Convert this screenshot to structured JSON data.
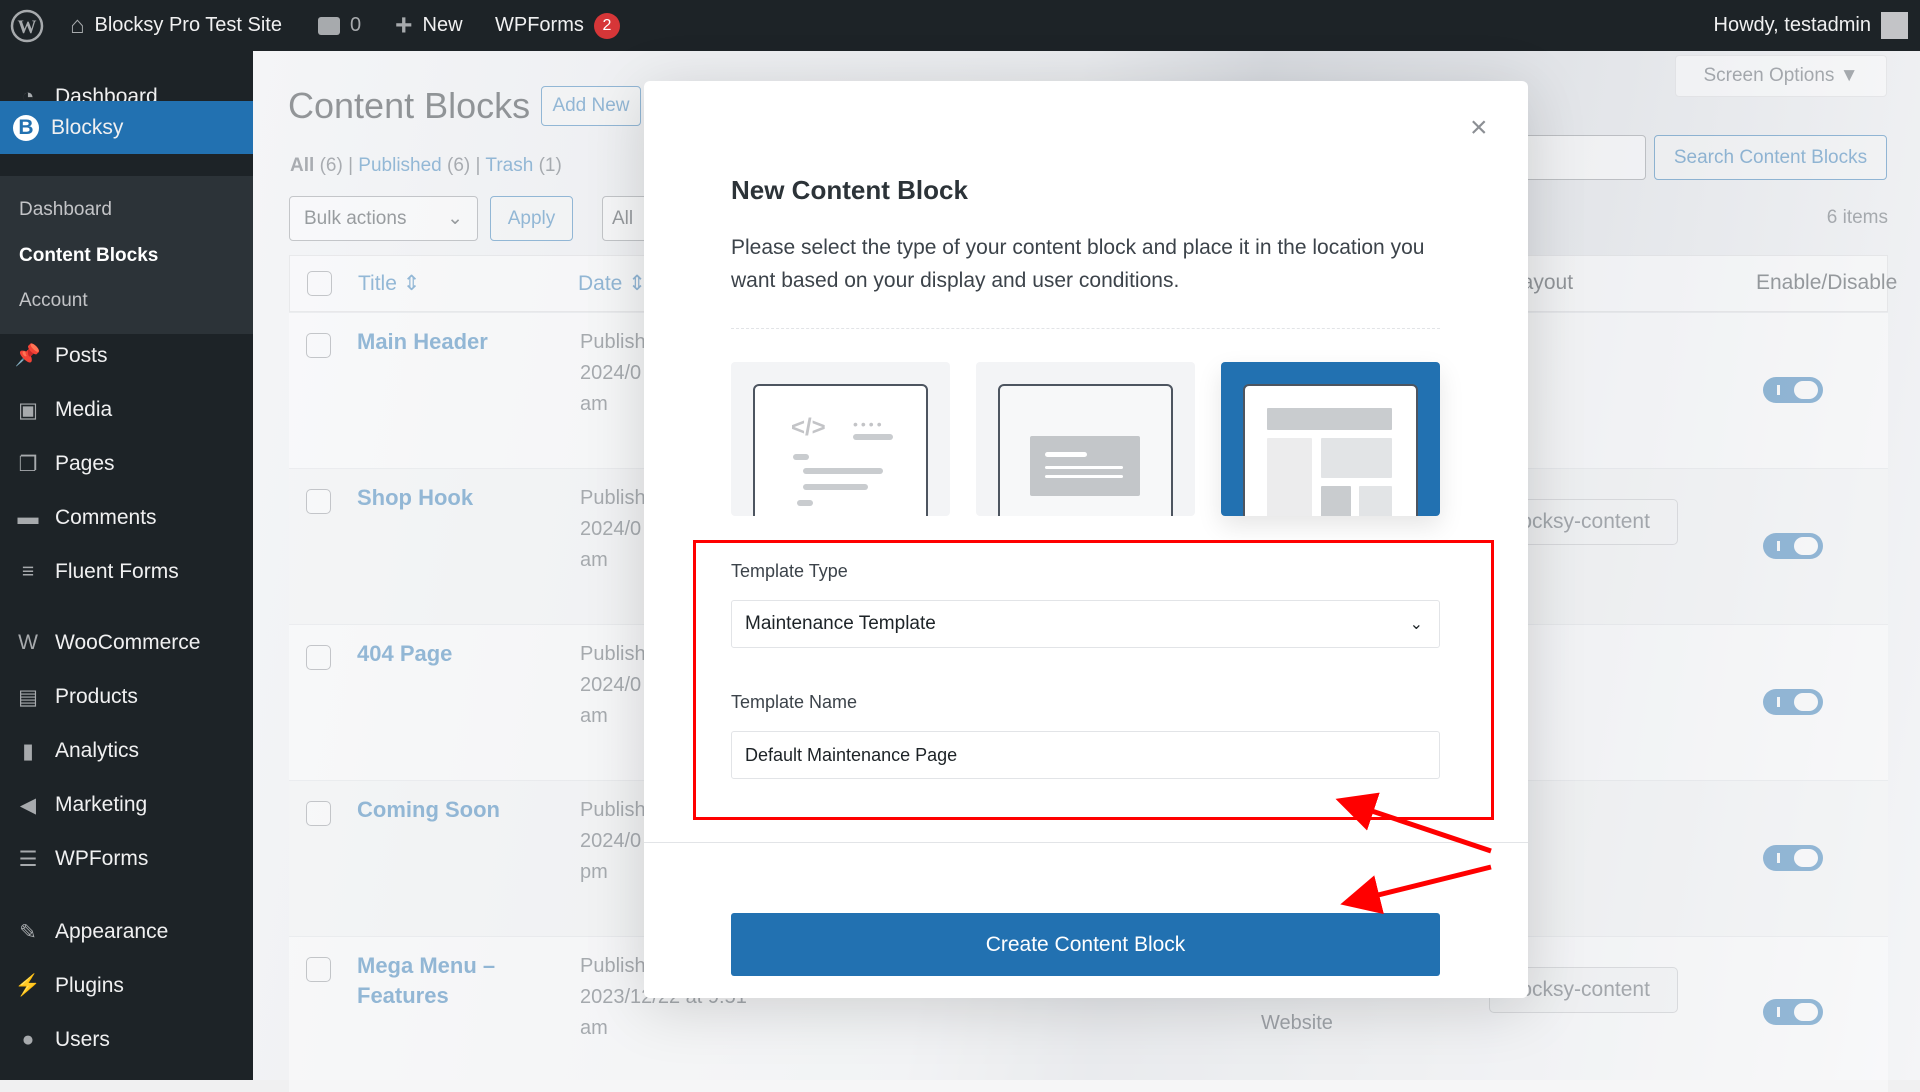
{
  "adminbar": {
    "site_name": "Blocksy Pro Test Site",
    "comments_count": "0",
    "new_label": "New",
    "wpforms_label": "WPForms",
    "wpforms_badge": "2",
    "howdy": "Howdy, testadmin"
  },
  "sidebar": {
    "items": [
      {
        "label": "Dashboard",
        "icon": "dashboard-icon"
      },
      {
        "label": "Blocksy",
        "icon": "blocksy-icon",
        "active": true
      },
      {
        "label": "Posts",
        "icon": "pin-icon"
      },
      {
        "label": "Media",
        "icon": "media-icon"
      },
      {
        "label": "Pages",
        "icon": "pages-icon"
      },
      {
        "label": "Comments",
        "icon": "comment-icon"
      },
      {
        "label": "Fluent Forms",
        "icon": "forms-icon"
      },
      {
        "label": "WooCommerce",
        "icon": "woo-icon"
      },
      {
        "label": "Products",
        "icon": "archive-icon"
      },
      {
        "label": "Analytics",
        "icon": "chart-icon"
      },
      {
        "label": "Marketing",
        "icon": "megaphone-icon"
      },
      {
        "label": "WPForms",
        "icon": "wpforms-icon"
      },
      {
        "label": "Appearance",
        "icon": "brush-icon"
      },
      {
        "label": "Plugins",
        "icon": "plug-icon"
      },
      {
        "label": "Users",
        "icon": "user-icon"
      }
    ],
    "submenu": [
      "Dashboard",
      "Content Blocks",
      "Account"
    ]
  },
  "page": {
    "title": "Content Blocks",
    "add_new": "Add New",
    "screen_options": "Screen Options",
    "filters": {
      "all": "All",
      "all_count": "(6)",
      "published": "Published",
      "published_count": "(6)",
      "trash": "Trash",
      "trash_count": "(1)"
    },
    "bulk_actions": "Bulk actions",
    "apply": "Apply",
    "all_dates": "All",
    "search_button": "Search Content Blocks",
    "items_count": "6 items",
    "columns": {
      "title": "Title",
      "date": "Date",
      "layout": "Layout",
      "enable": "Enable/Disable"
    },
    "rows": [
      {
        "title": "Main Header",
        "status": "Published",
        "date": "2024/0",
        "time": "am",
        "shortcode": "",
        "enabled": true
      },
      {
        "title": "Shop Hook",
        "status": "Published",
        "date": "2024/0",
        "time": "am",
        "shortcode": "blocksy-content",
        "enabled": true
      },
      {
        "title": "404 Page",
        "status": "Published",
        "date": "2024/0",
        "time": "am",
        "shortcode": "",
        "enabled": true
      },
      {
        "title": "Coming Soon",
        "status": "Published",
        "date": "2024/0",
        "time": "pm",
        "shortcode": "",
        "enabled": true
      },
      {
        "title": "Mega Menu – Features",
        "status": "Published",
        "date": "2023/12/22 at 9:51",
        "time": "am",
        "shortcode": "blocksy-content",
        "extra": "Website",
        "enabled": true
      }
    ]
  },
  "modal": {
    "title": "New Content Block",
    "description": "Please select the type of your content block and place it in the location you want based on your display and user conditions.",
    "close": "×",
    "types": [
      {
        "name": "hook",
        "selected": false
      },
      {
        "name": "popup",
        "selected": false
      },
      {
        "name": "template",
        "selected": true
      }
    ],
    "template_type_label": "Template Type",
    "template_type_value": "Maintenance Template",
    "template_name_label": "Template Name",
    "template_name_value": "Default Maintenance Page",
    "submit": "Create Content Block"
  },
  "colors": {
    "accent": "#2271b1",
    "adminbar": "#1d2327",
    "annotation": "#ff0000"
  }
}
